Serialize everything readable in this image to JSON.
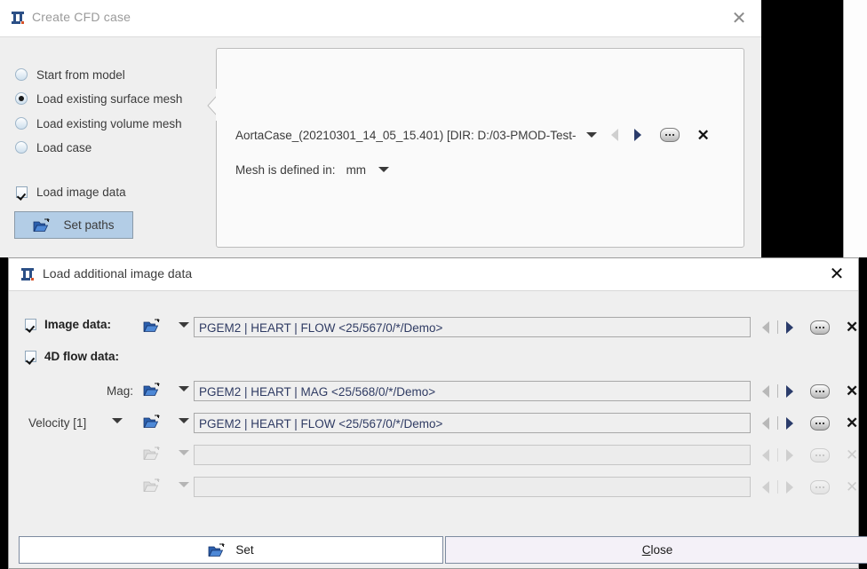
{
  "background_window": {
    "title": "Create CFD case",
    "title_icon": "pmod-logo-icon",
    "close_icon": "✕",
    "options": [
      {
        "label": "Start from model",
        "selected": false
      },
      {
        "label": "Load existing surface mesh",
        "selected": true
      },
      {
        "label": "Load existing volume mesh",
        "selected": false
      },
      {
        "label": "Load case",
        "selected": false
      }
    ],
    "load_image_data": {
      "label": "Load image data",
      "checked": true
    },
    "set_paths_button": {
      "label": "Set paths",
      "icon": "open-folder-icon"
    },
    "panel": {
      "mesh_name": "AortaCase_(20210301_14_05_15.401) [DIR: D:/03-PMOD-Test-",
      "mesh_unit_label": "Mesh is defined in:",
      "mesh_unit_value": "mm"
    }
  },
  "dialog": {
    "title": "Load additional image data",
    "title_icon": "pmod-logo-icon",
    "close_icon": "✕",
    "rows": [
      {
        "id": "image-data",
        "label": "Image data:",
        "label_bold": true,
        "checkbox": true,
        "checked": true,
        "value": "PGEM2 | HEART | FLOW <25/567/0/*/Demo>",
        "enabled": true
      },
      {
        "id": "4d-flow-data",
        "label": "4D flow data:",
        "label_bold": true,
        "checkbox": true,
        "checked": true,
        "value": null,
        "enabled": true
      },
      {
        "id": "mag",
        "label": "Mag:",
        "label_bold": false,
        "checkbox": false,
        "value": "PGEM2 | HEART | MAG <25/568/0/*/Demo>",
        "enabled": true
      },
      {
        "id": "velocity",
        "label": "Velocity  [1]",
        "label_bold": false,
        "checkbox": false,
        "has_index_dropdown": true,
        "value": "PGEM2 | HEART | FLOW <25/567/0/*/Demo>",
        "enabled": true
      },
      {
        "id": "empty-1",
        "label": "",
        "label_bold": false,
        "checkbox": false,
        "value": "",
        "enabled": false
      },
      {
        "id": "empty-2",
        "label": "",
        "label_bold": false,
        "checkbox": false,
        "value": "",
        "enabled": false
      }
    ],
    "row_icons": {
      "folder": "open-folder-icon",
      "dropdown": "chevron-down-icon",
      "prev": "prev-arrow-icon",
      "next": "next-arrow-icon",
      "more": "more-options-icon",
      "clear": "clear-x-icon"
    },
    "buttons": {
      "set": {
        "label": "Set",
        "icon": "open-folder-icon"
      },
      "close": {
        "label_before": "",
        "label_underlined": "C",
        "label_after": "lose"
      }
    }
  },
  "colors": {
    "window_bg": "#efefef",
    "titlebar_bg": "#ffffff",
    "accent_button": "#b3cde6",
    "field_text": "#2f3b63",
    "close_button_bg": "#f4f1f8"
  }
}
